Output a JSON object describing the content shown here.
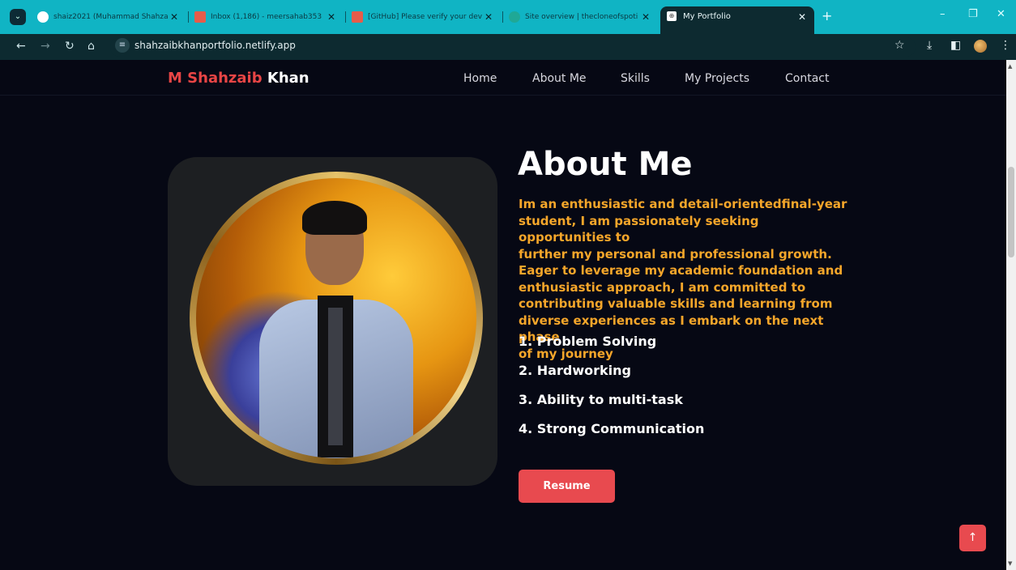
{
  "browser": {
    "tabs": [
      {
        "title": "shaiz2021 (Muhammad Shahza",
        "icon": "github-icon"
      },
      {
        "title": "Inbox (1,186) - meersahab353",
        "icon": "gmail-icon"
      },
      {
        "title": "[GitHub] Please verify your dev",
        "icon": "gmail-icon"
      },
      {
        "title": "Site overview | thecloneofspoti",
        "icon": "netlify-icon"
      }
    ],
    "active_tab": {
      "title": "My Portfolio"
    },
    "url": "shahzaibkhanportfolio.netlify.app"
  },
  "navbar": {
    "brand_first": "M Shahzaib",
    "brand_last": "Khan",
    "links": [
      "Home",
      "About Me",
      "Skills",
      "My Projects",
      "Contact"
    ]
  },
  "about": {
    "title": "About Me",
    "description_lines": [
      "Im an enthusiastic and detail-orientedfinal-year",
      "student, I am passionately seeking opportunities to",
      "further my personal and professional growth.",
      "Eager to leverage my academic foundation and",
      "enthusiastic approach, I am committed to",
      "contributing valuable skills and learning from",
      "diverse experiences as I embark on the next phase",
      "of my journey"
    ],
    "skills": [
      "1. Problem Solving",
      "2. Hardworking",
      "3. Ability to multi-task",
      "4. Strong Communication"
    ],
    "resume_label": "Resume",
    "scroll_top_label": "↑"
  },
  "colors": {
    "accent_red": "#e84a4f",
    "accent_orange": "#f5a62a",
    "background": "#060814"
  }
}
